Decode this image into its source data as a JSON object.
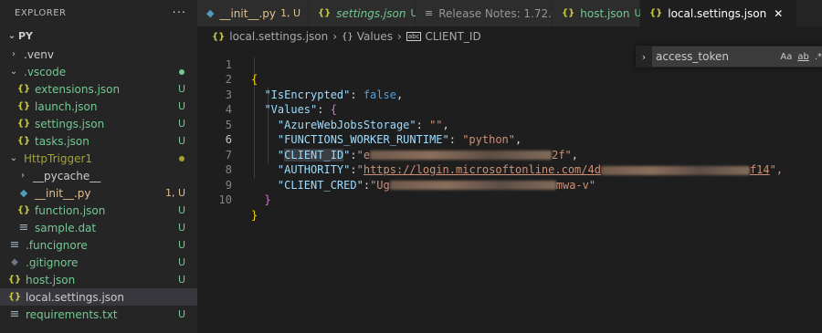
{
  "explorer": {
    "title": "EXPLORER",
    "more": "···",
    "root": "PY",
    "items": [
      {
        "label": ".venv",
        "type": "folder-closed",
        "badge": "",
        "dot": "",
        "depth": 1
      },
      {
        "label": ".vscode",
        "type": "folder-open",
        "badge": "",
        "dot": "#73c991",
        "depth": 1
      },
      {
        "label": "extensions.json",
        "type": "json",
        "badge": "U",
        "dot": "",
        "depth": 2
      },
      {
        "label": "launch.json",
        "type": "json",
        "badge": "U",
        "dot": "",
        "depth": 2
      },
      {
        "label": "settings.json",
        "type": "json",
        "badge": "U",
        "dot": "",
        "depth": 2
      },
      {
        "label": "tasks.json",
        "type": "json",
        "badge": "U",
        "dot": "",
        "depth": 2
      },
      {
        "label": "HttpTrigger1",
        "type": "folder-open",
        "badge": "",
        "dot": "#a3a335",
        "depth": 1
      },
      {
        "label": "__pycache__",
        "type": "folder-closed",
        "badge": "",
        "dot": "",
        "depth": 2
      },
      {
        "label": "__init__.py",
        "type": "py",
        "badge": "1, U",
        "dot": "",
        "depth": 2
      },
      {
        "label": "function.json",
        "type": "json",
        "badge": "U",
        "dot": "",
        "depth": 2
      },
      {
        "label": "sample.dat",
        "type": "generic",
        "badge": "U",
        "dot": "",
        "depth": 2
      },
      {
        "label": ".funcignore",
        "type": "generic",
        "badge": "U",
        "dot": "",
        "depth": 1
      },
      {
        "label": ".gitignore",
        "type": "git",
        "badge": "U",
        "dot": "",
        "depth": 1
      },
      {
        "label": "host.json",
        "type": "json",
        "badge": "U",
        "dot": "",
        "depth": 1
      },
      {
        "label": "local.settings.json",
        "type": "json",
        "badge": "",
        "dot": "",
        "depth": 1,
        "selected": true
      },
      {
        "label": "requirements.txt",
        "type": "generic",
        "badge": "U",
        "dot": "",
        "depth": 1
      }
    ]
  },
  "tabs": [
    {
      "label": "__init__.py",
      "icon": "py",
      "mod": "1, U",
      "state": "dirty",
      "italic": false
    },
    {
      "label": "settings.json",
      "icon": "json",
      "mod": "U",
      "state": "",
      "italic": true
    },
    {
      "label": "Release Notes: 1.72.0",
      "icon": "notes",
      "mod": "",
      "state": "",
      "italic": false
    },
    {
      "label": "host.json",
      "icon": "json",
      "mod": "U",
      "state": "",
      "italic": false
    },
    {
      "label": "local.settings.json",
      "icon": "json",
      "mod": "",
      "state": "active",
      "italic": false
    }
  ],
  "breadcrumb": {
    "file": "local.settings.json",
    "section": "Values",
    "key": "CLIENT_ID"
  },
  "find": {
    "query": "access_token",
    "opt_case": "Aa",
    "opt_word": "ab",
    "opt_regex": ".*"
  },
  "editor": {
    "line_numbers": [
      "1",
      "2",
      "3",
      "4",
      "5",
      "6",
      "7",
      "8",
      "9",
      "10"
    ],
    "current_line": 6,
    "lines": {
      "l1_open": "{",
      "l2_key": "\"IsEncrypted\"",
      "l2_colon": ": ",
      "l2_val": "false",
      "l2_comma": ",",
      "l3_key": "\"Values\"",
      "l3_colon": ": ",
      "l3_open": "{",
      "l4_key": "\"AzureWebJobsStorage\"",
      "l4_colon": ": ",
      "l4_val": "\"\"",
      "l4_comma": ",",
      "l5_key": "\"FUNCTIONS_WORKER_RUNTIME\"",
      "l5_colon": ": ",
      "l5_val": "\"python\"",
      "l5_comma": ",",
      "l6_q1": "\"",
      "l6_key": "CLIENT_ID",
      "l6_q2": "\"",
      "l6_colon": ":",
      "l6_val_start": "\"e",
      "l6_val_end": "2f\"",
      "l6_comma": ",",
      "l7_key": "\"AUTHORITY\"",
      "l7_colon": ":",
      "l7_q": "\"",
      "l7_url": "https://login.microsoftonline.com/4d",
      "l7_url_end": "f14",
      "l7_end": "\",",
      "l8_key": "\"CLIENT_CRED\"",
      "l8_colon": ":",
      "l8_val_start": "\"Ug",
      "l8_val_end": "mwa-v\"",
      "l9_close": "}",
      "l10_close": "}"
    }
  }
}
